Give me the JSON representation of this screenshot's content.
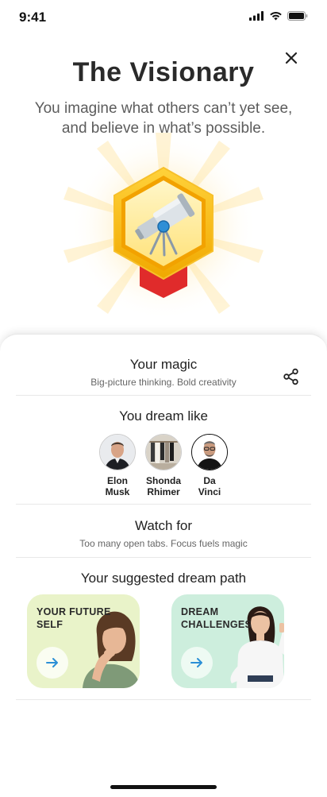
{
  "status": {
    "time": "9:41"
  },
  "header": {
    "title": "The Visionary",
    "subtitle": "You imagine what others can’t yet see, and believe in what’s possible."
  },
  "badge": {
    "icon": "telescope-icon",
    "hex_color": "#f5b800",
    "ribbon_color": "#e02b2b"
  },
  "magic": {
    "title": "Your magic",
    "subtitle": "Big-picture thinking. Bold creativity"
  },
  "dream_like": {
    "title": "You dream like",
    "people": [
      {
        "name_line1": "Elon",
        "name_line2": "Musk"
      },
      {
        "name_line1": "Shonda",
        "name_line2": "Rhimer"
      },
      {
        "name_line1": "Da",
        "name_line2": "Vinci"
      }
    ]
  },
  "watch_for": {
    "title": "Watch for",
    "subtitle": "Too many open tabs. Focus fuels magic"
  },
  "dream_path": {
    "title": "Your suggested dream path",
    "cards": [
      {
        "label_line1": "YOUR FUTURE",
        "label_line2": "SELF",
        "bg": "#e9f3c9"
      },
      {
        "label_line1": "DREAM",
        "label_line2": "CHALLENGES",
        "bg": "#cdeedd"
      }
    ]
  },
  "colors": {
    "accent_arrow": "#2b8fd6",
    "text_dark": "#1f1f1f"
  }
}
